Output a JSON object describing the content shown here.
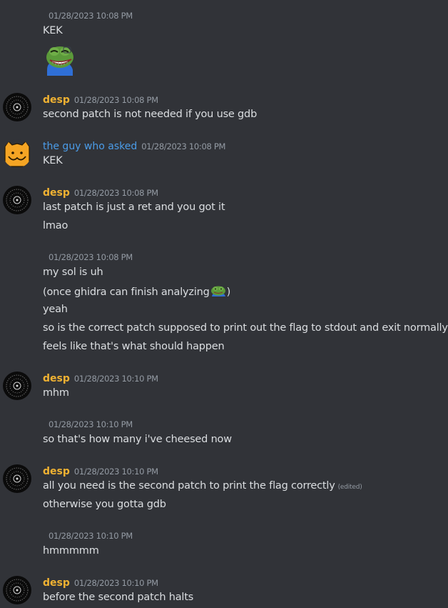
{
  "colors": {
    "background": "#313338",
    "text": "#dbdee1",
    "timestamp": "#949ba4",
    "desp_name": "#f0b232",
    "guy_name": "#4b9ce8"
  },
  "messages": [
    {
      "type": "continuation",
      "timestamp": "01/28/2023 10:08 PM",
      "lines": [
        "KEK"
      ],
      "emoji": "pepe-laugh-emoji"
    },
    {
      "type": "full",
      "author": "desp",
      "avatar": "desp-avatar",
      "timestamp": "01/28/2023 10:08 PM",
      "lines": [
        "second patch is not needed if you use gdb"
      ]
    },
    {
      "type": "full",
      "author": "the guy who asked",
      "avatar": "orange-smiley-avatar",
      "timestamp": "01/28/2023 10:08 PM",
      "lines": [
        "KEK"
      ]
    },
    {
      "type": "full",
      "author": "desp",
      "avatar": "desp-avatar",
      "timestamp": "01/28/2023 10:08 PM",
      "lines": [
        "last patch is just a ret and you got it",
        "lmao"
      ]
    },
    {
      "type": "continuation",
      "timestamp": "01/28/2023 10:08 PM",
      "lines": [
        "my sol is uh",
        "(once ghidra can finish analyzing",
        ")",
        "yeah",
        "so is the correct patch supposed to print out the flag to stdout and exit normally lol",
        "feels like that's what should happen"
      ]
    },
    {
      "type": "full",
      "author": "desp",
      "avatar": "desp-avatar",
      "timestamp": "01/28/2023 10:10 PM",
      "lines": [
        "mhm"
      ]
    },
    {
      "type": "continuation",
      "timestamp": "01/28/2023 10:10 PM",
      "lines": [
        "so that's how many i've cheesed now"
      ]
    },
    {
      "type": "full",
      "author": "desp",
      "avatar": "desp-avatar",
      "timestamp": "01/28/2023 10:10 PM",
      "lines": [
        "all you need is the second patch to print the flag correctly",
        "otherwise you gotta gdb"
      ],
      "edited": "(edited)"
    },
    {
      "type": "continuation",
      "timestamp": "01/28/2023 10:10 PM",
      "lines": [
        "hmmmmm"
      ]
    },
    {
      "type": "full",
      "author": "desp",
      "avatar": "desp-avatar",
      "timestamp": "01/28/2023 10:10 PM",
      "lines": [
        "before the second patch halts"
      ]
    }
  ]
}
